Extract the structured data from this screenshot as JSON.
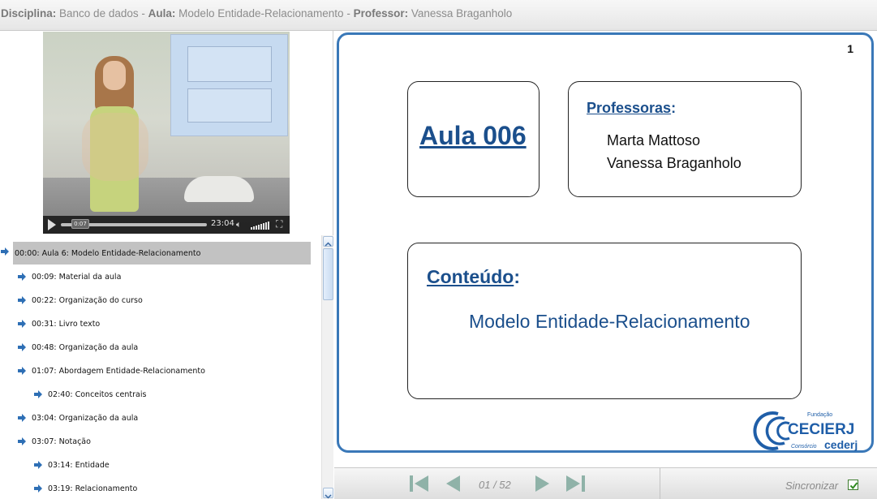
{
  "header": {
    "disciplina_label": "Disciplina:",
    "disciplina_value": "Banco de dados",
    "sep1": "-",
    "aula_label": "Aula:",
    "aula_value": "Modelo Entidade-Relacionamento",
    "sep2": "-",
    "professor_label": "Professor:",
    "professor_value": "Vanessa Braganholo"
  },
  "video": {
    "current_time": "0:07",
    "duration": "23:04",
    "progress_fraction": 0.005
  },
  "chapters": [
    {
      "label": "00:00: Aula 6: Modelo Entidade-Relacionamento",
      "level": 0,
      "selected": true
    },
    {
      "label": "00:09: Material da aula",
      "level": 1
    },
    {
      "label": "00:22: Organização do curso",
      "level": 1
    },
    {
      "label": "00:31: Livro texto",
      "level": 1
    },
    {
      "label": "00:48: Organização da aula",
      "level": 1
    },
    {
      "label": "01:07: Abordagem Entidade-Relacionamento",
      "level": 1
    },
    {
      "label": "02:40: Conceitos centrais",
      "level": 2
    },
    {
      "label": "03:04: Organização da aula",
      "level": 1
    },
    {
      "label": "03:07: Notação",
      "level": 1
    },
    {
      "label": "03:14: Entidade",
      "level": 2
    },
    {
      "label": "03:19: Relacionamento",
      "level": 2
    }
  ],
  "slide": {
    "number": "1",
    "aula_title": "Aula 006",
    "professoras_heading": "Professoras",
    "professoras_colon": ":",
    "professoras": [
      "Marta Mattoso",
      "Vanessa Braganholo"
    ],
    "conteudo_heading": "Conteúdo",
    "conteudo_colon": ":",
    "conteudo_text": "Modelo Entidade-Relacionamento",
    "logo": {
      "fundacao": "Fundação",
      "cecierj": "CECIERJ",
      "consorcio": "Consórcio",
      "cederj": "cederj"
    }
  },
  "navbar": {
    "page_indicator": "01 / 52",
    "sync_label": "Sincronizar",
    "sync_checked": true
  },
  "colors": {
    "slide_border": "#3a78b8",
    "slide_heading": "#1b4f8c",
    "nav_arrow": "#8fb2a8",
    "chapter_arrow": "#2e6fb5"
  }
}
